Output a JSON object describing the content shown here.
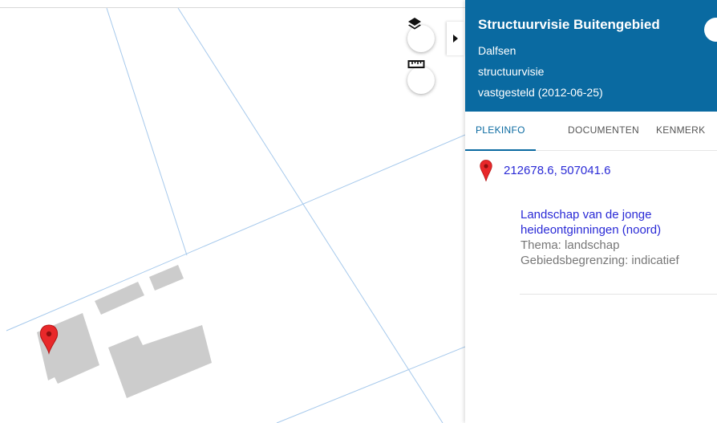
{
  "map": {
    "layers_icon": "layers-icon",
    "measure_icon": "ruler-icon",
    "marker_icon": "map-marker-icon",
    "toggle_icon": "caret-right-icon",
    "colors": {
      "building": "#cccccc",
      "parcel_line": "#a6c9ec",
      "marker": "#e8282a"
    }
  },
  "panel": {
    "title": "Structuurvisie Buitengebied",
    "municipality": "Dalfsen",
    "plan_type": "structuurvisie",
    "status": "vastgesteld (2012-06-25)",
    "header_color": "#0a6aa1",
    "tabs": [
      {
        "label": "PLEKINFO",
        "active": true
      },
      {
        "label": "DOCUMENTEN",
        "active": false
      },
      {
        "label": "KENMERK",
        "active": false
      }
    ],
    "location": {
      "icon": "map-marker-icon",
      "coordinates": "212678.6, 507041.6"
    },
    "feature": {
      "name_line1": "Landschap van de jonge",
      "name_line2": "heideontginningen (noord)",
      "theme": "Thema: landschap",
      "boundary": "Gebiedsbegrenzing: indicatief"
    }
  }
}
